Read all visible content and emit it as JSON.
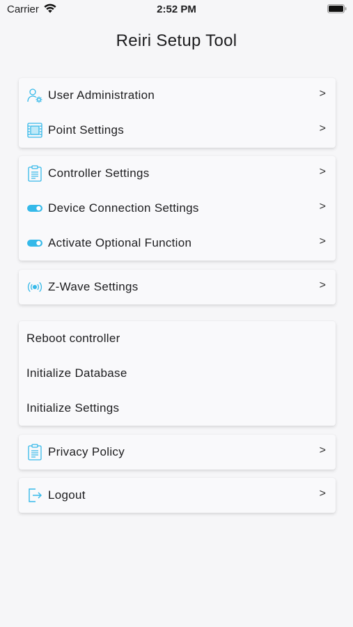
{
  "status_bar": {
    "carrier": "Carrier",
    "time": "2:52 PM"
  },
  "page_title": "Reiri Setup Tool",
  "chevron": ">",
  "accent_color": "#35b9e9",
  "groups": [
    {
      "items": [
        {
          "label": "User Administration",
          "icon": "user-gear-icon"
        },
        {
          "label": "Point Settings",
          "icon": "chip-icon"
        }
      ]
    },
    {
      "items": [
        {
          "label": "Controller Settings",
          "icon": "clipboard-icon"
        },
        {
          "label": "Device Connection Settings",
          "icon": "toggle-icon"
        },
        {
          "label": "Activate Optional Function",
          "icon": "toggle-icon"
        }
      ]
    },
    {
      "items": [
        {
          "label": "Z-Wave Settings",
          "icon": "wireless-icon"
        }
      ]
    },
    {
      "items": [
        {
          "label": "Reboot controller"
        },
        {
          "label": "Initialize Database"
        },
        {
          "label": "Initialize Settings"
        }
      ]
    },
    {
      "items": [
        {
          "label": "Privacy Policy",
          "icon": "clipboard-icon"
        }
      ]
    },
    {
      "items": [
        {
          "label": "Logout",
          "icon": "logout-icon"
        }
      ]
    }
  ]
}
